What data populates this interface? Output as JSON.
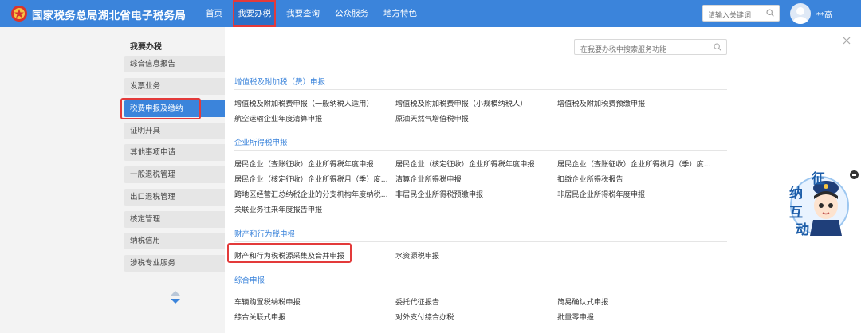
{
  "header": {
    "site_title": "国家税务总局湖北省电子税务局",
    "nav": [
      "首页",
      "我要办税",
      "我要查询",
      "公众服务",
      "地方特色"
    ],
    "nav_active": "我要办税",
    "search_placeholder": "请输入关键词",
    "user_name": "**高"
  },
  "sidebar": {
    "title": "我要办税",
    "items": [
      "综合信息报告",
      "发票业务",
      "税费申报及缴纳",
      "证明开具",
      "其他事项申请",
      "一般退税管理",
      "出口退税管理",
      "核定管理",
      "纳税信用",
      "涉税专业服务"
    ],
    "active_item": "税费申报及缴纳"
  },
  "main": {
    "search_placeholder": "在我要办税中搜索服务功能",
    "sections": [
      {
        "title": "增值税及附加税（费）申报",
        "rows": [
          [
            "增值税及附加税费申报（一般纳税人适用）",
            "增值税及附加税费申报（小规模纳税人）",
            "增值税及附加税费预缴申报"
          ],
          [
            "航空运输企业年度清算申报",
            "原油天然气增值税申报",
            ""
          ]
        ]
      },
      {
        "title": "企业所得税申报",
        "rows": [
          [
            "居民企业（查账征收）企业所得税年度申报",
            "居民企业（核定征收）企业所得税年度申报",
            "居民企业（查账征收）企业所得税月（季）度..."
          ],
          [
            "居民企业（核定征收）企业所得税月（季）度...",
            "清算企业所得税申报",
            "扣缴企业所得税报告"
          ],
          [
            "跨地区经营汇总纳税企业的分支机构年度纳税...",
            "非居民企业所得税预缴申报",
            "非居民企业所得税年度申报"
          ],
          [
            "关联业务往来年度报告申报",
            "",
            ""
          ]
        ]
      },
      {
        "title": "财产和行为税申报",
        "rows": [
          [
            "财产和行为税税源采集及合并申报",
            "水资源税申报",
            ""
          ]
        ]
      },
      {
        "title": "综合申报",
        "rows": [
          [
            "车辆购置税纳税申报",
            "委托代征报告",
            "简易确认式申报"
          ],
          [
            "综合关联式申报",
            "对外支付综合办税",
            "批量零申报"
          ]
        ]
      }
    ]
  },
  "widget": {
    "chars": [
      "征",
      "纳",
      "互",
      "动"
    ]
  },
  "colors": {
    "primary": "#3b84db",
    "highlight_box": "#e33a3a",
    "sidebar_bg": "#f3f3f3"
  }
}
